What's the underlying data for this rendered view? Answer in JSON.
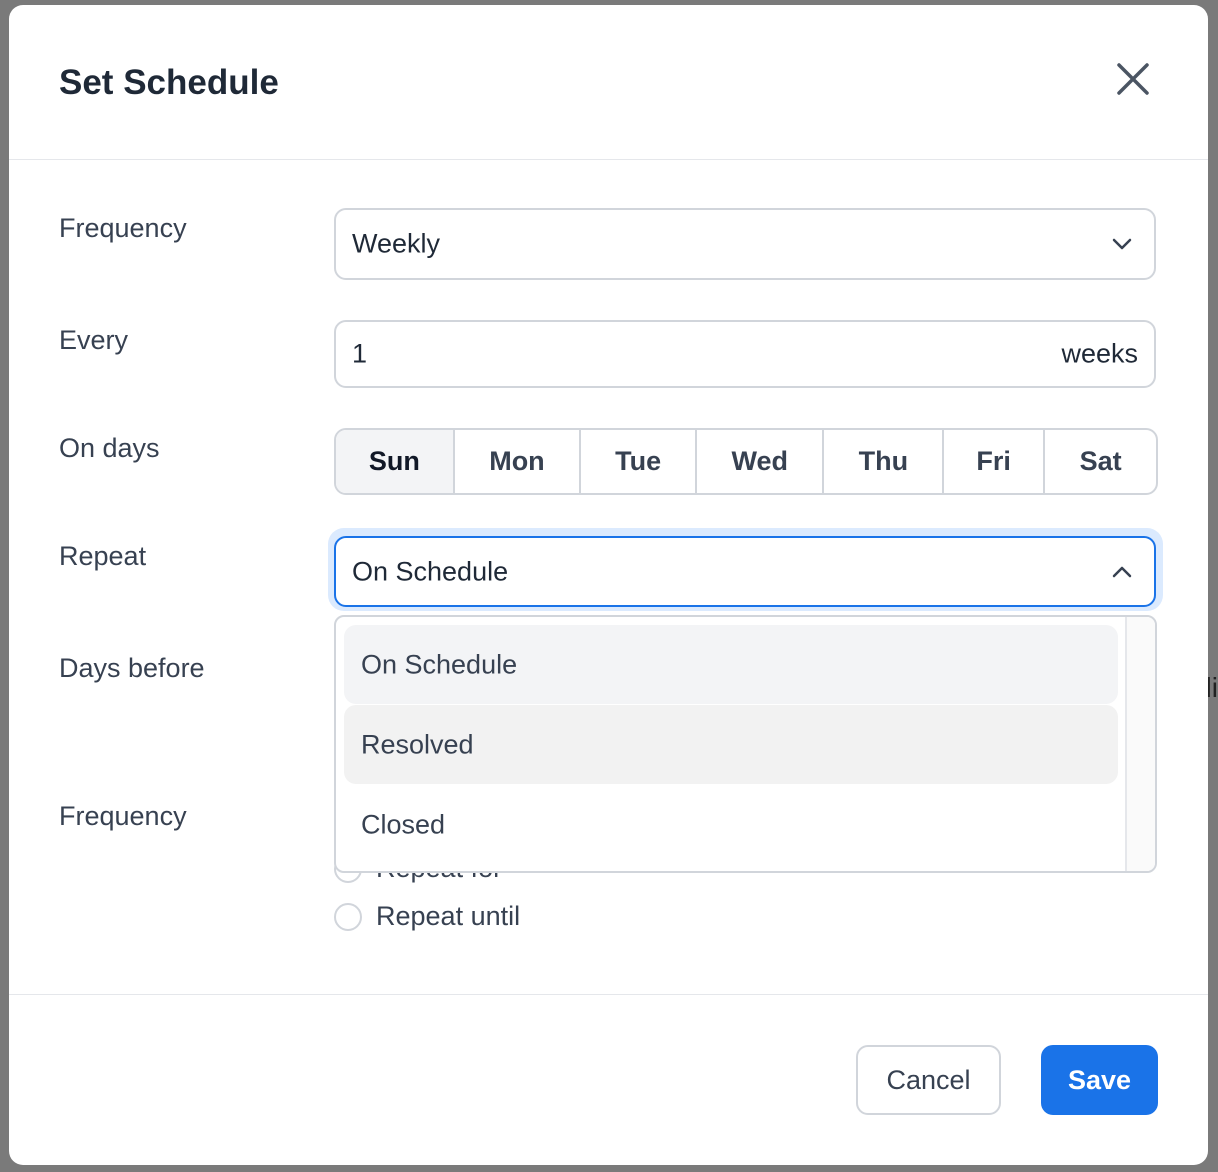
{
  "dialog": {
    "title": "Set Schedule",
    "close_icon": "close-icon"
  },
  "form": {
    "frequency_label": "Frequency",
    "frequency_value": "Weekly",
    "every_label": "Every",
    "every_value": "1",
    "every_unit": "weeks",
    "on_days_label": "On days",
    "days": [
      "Sun",
      "Mon",
      "Tue",
      "Wed",
      "Thu",
      "Fri",
      "Sat"
    ],
    "selected_day": "Sun",
    "repeat_label": "Repeat",
    "repeat_value": "On Schedule",
    "repeat_options": [
      "On Schedule",
      "Resolved",
      "Closed"
    ],
    "days_before_label": "Days before",
    "end_frequency_label": "Frequency",
    "end_options": [
      "Repeat for",
      "Repeat until"
    ]
  },
  "footer": {
    "cancel_label": "Cancel",
    "save_label": "Save"
  },
  "colors": {
    "primary": "#1a73e8",
    "focus_ring": "#dbeafe"
  }
}
